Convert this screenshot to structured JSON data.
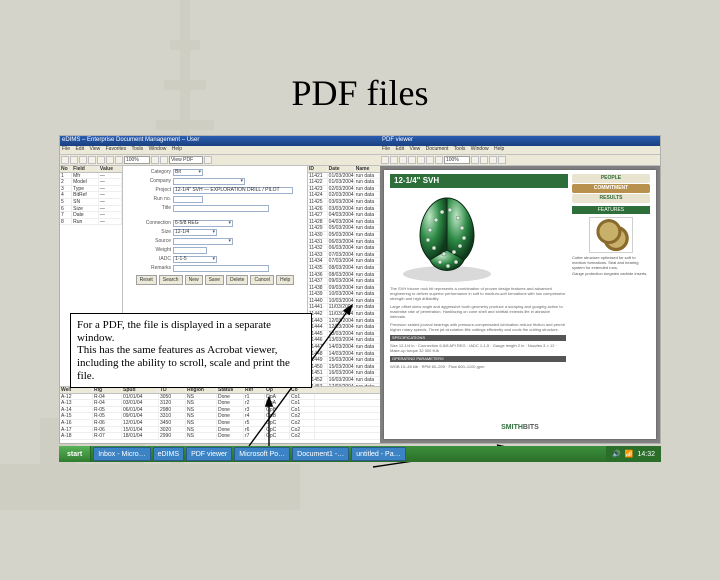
{
  "slide": {
    "title": "PDF files"
  },
  "callout": {
    "text": "For a PDF, the file is displayed in a separate window.\nThis has the same features as Acrobat viewer, including the ability to scroll, scale and print the file."
  },
  "app": {
    "title": "eDIMS – Enterprise Document Management – User",
    "menu": [
      "File",
      "Edit",
      "View",
      "Favorites",
      "Tools",
      "Window",
      "Help"
    ],
    "toolbar": {
      "scale": "100%",
      "view_label": "View PDF"
    },
    "form": {
      "labels": {
        "category": "Category",
        "company": "Company",
        "project": "Project",
        "runno": "Run no.",
        "title": "Title",
        "connection": "Connection",
        "size": "Size",
        "source": "Source",
        "weight": "Weight",
        "iadc": "IADC",
        "remarks": "Remarks"
      },
      "values": {
        "category": "Bit",
        "company": "",
        "project": "12-1/4\" SVH — EXPLORATION DRILL / PILOT",
        "runno": "",
        "title": "",
        "connection": "6-5/8 REG",
        "size": "12-1/4",
        "source": "",
        "weight": "",
        "iadc": "1-1-5",
        "remarks": ""
      },
      "buttons": [
        "Reset",
        "Search",
        "New",
        "Save",
        "Delete",
        "Cancel",
        "Help"
      ]
    },
    "left_grid": {
      "headers": [
        "No",
        "Field",
        "Value"
      ],
      "rows": [
        [
          "1",
          "Mfr",
          "—"
        ],
        [
          "2",
          "Model",
          "—"
        ],
        [
          "3",
          "Type",
          "—"
        ],
        [
          "4",
          "BitRef",
          "—"
        ],
        [
          "5",
          "SN",
          "—"
        ],
        [
          "6",
          "Size",
          "—"
        ],
        [
          "7",
          "Date",
          "—"
        ],
        [
          "8",
          "Run",
          "—"
        ]
      ]
    },
    "right_grid": {
      "headers": [
        "ID",
        "Date",
        "Name"
      ],
      "rows": [
        [
          "11421",
          "01/03/2004",
          "run data"
        ],
        [
          "11422",
          "01/03/2004",
          "run data"
        ],
        [
          "11423",
          "02/03/2004",
          "run data"
        ],
        [
          "11424",
          "02/03/2004",
          "run data"
        ],
        [
          "11425",
          "03/03/2004",
          "run data"
        ],
        [
          "11426",
          "03/03/2004",
          "run data"
        ],
        [
          "11427",
          "04/03/2004",
          "run data"
        ],
        [
          "11428",
          "04/03/2004",
          "run data"
        ],
        [
          "11429",
          "05/03/2004",
          "run data"
        ],
        [
          "11430",
          "05/03/2004",
          "run data"
        ],
        [
          "11431",
          "06/03/2004",
          "run data"
        ],
        [
          "11432",
          "06/03/2004",
          "run data"
        ],
        [
          "11433",
          "07/03/2004",
          "run data"
        ],
        [
          "11434",
          "07/03/2004",
          "run data"
        ],
        [
          "11435",
          "08/03/2004",
          "run data"
        ],
        [
          "11436",
          "08/03/2004",
          "run data"
        ],
        [
          "11437",
          "09/03/2004",
          "run data"
        ],
        [
          "11438",
          "09/03/2004",
          "run data"
        ],
        [
          "11439",
          "10/03/2004",
          "run data"
        ],
        [
          "11440",
          "10/03/2004",
          "run data"
        ],
        [
          "11441",
          "11/03/2004",
          "run data"
        ],
        [
          "11442",
          "11/03/2004",
          "run data"
        ],
        [
          "11443",
          "12/03/2004",
          "run data"
        ],
        [
          "11444",
          "12/03/2004",
          "run data"
        ],
        [
          "11445",
          "13/03/2004",
          "run data"
        ],
        [
          "11446",
          "13/03/2004",
          "run data"
        ],
        [
          "11447",
          "14/03/2004",
          "run data"
        ],
        [
          "11448",
          "14/03/2004",
          "run data"
        ],
        [
          "11449",
          "15/03/2004",
          "run data"
        ],
        [
          "11450",
          "15/03/2004",
          "run data"
        ],
        [
          "11451",
          "16/03/2004",
          "run data"
        ],
        [
          "11452",
          "16/03/2004",
          "run data"
        ],
        [
          "11453",
          "17/03/2004",
          "run data"
        ]
      ]
    },
    "bottom_grid": {
      "headers": [
        "Well",
        "Rig",
        "Spud",
        "TD",
        "Region",
        "Status",
        "Ref",
        "Op",
        "Co"
      ],
      "rows": [
        [
          "A-12",
          "R-04",
          "01/01/04",
          "3050",
          "NS",
          "Done",
          "r1",
          "OpA",
          "Co1"
        ],
        [
          "A-13",
          "R-04",
          "03/01/04",
          "3120",
          "NS",
          "Done",
          "r2",
          "OpA",
          "Co1"
        ],
        [
          "A-14",
          "R-05",
          "06/01/04",
          "2980",
          "NS",
          "Done",
          "r3",
          "OpB",
          "Co1"
        ],
        [
          "A-15",
          "R-05",
          "09/01/04",
          "3310",
          "NS",
          "Done",
          "r4",
          "OpB",
          "Co2"
        ],
        [
          "A-16",
          "R-06",
          "12/01/04",
          "3450",
          "NS",
          "Done",
          "r5",
          "OpC",
          "Co2"
        ],
        [
          "A-17",
          "R-06",
          "15/01/04",
          "3020",
          "NS",
          "Done",
          "r6",
          "OpC",
          "Co2"
        ],
        [
          "A-18",
          "R-07",
          "18/01/04",
          "2990",
          "NS",
          "Done",
          "r7",
          "OpC",
          "Co2"
        ]
      ]
    }
  },
  "pdf": {
    "window_title": "PDF viewer",
    "menu": [
      "File",
      "Edit",
      "View",
      "Document",
      "Tools",
      "Window",
      "Help"
    ],
    "toolbar": {
      "zoom": "100%"
    },
    "title": "12-1/4\" SVH",
    "badge": [
      "PEOPLE",
      "COMMITMENT",
      "RESULTS"
    ],
    "features_heading": "FEATURES",
    "sections": {
      "spec": "SPECIFICATIONS",
      "op": "OPERATING PARAMETERS"
    },
    "brand": {
      "a": "SMITH",
      "b": "BITS"
    }
  },
  "taskbar": {
    "start": "start",
    "items": [
      "Inbox - Micro…",
      "eDIMS",
      "PDF viewer",
      "Microsoft Po…",
      "Document1 -…",
      "untitled - Pa…"
    ],
    "clock": "14:32"
  }
}
